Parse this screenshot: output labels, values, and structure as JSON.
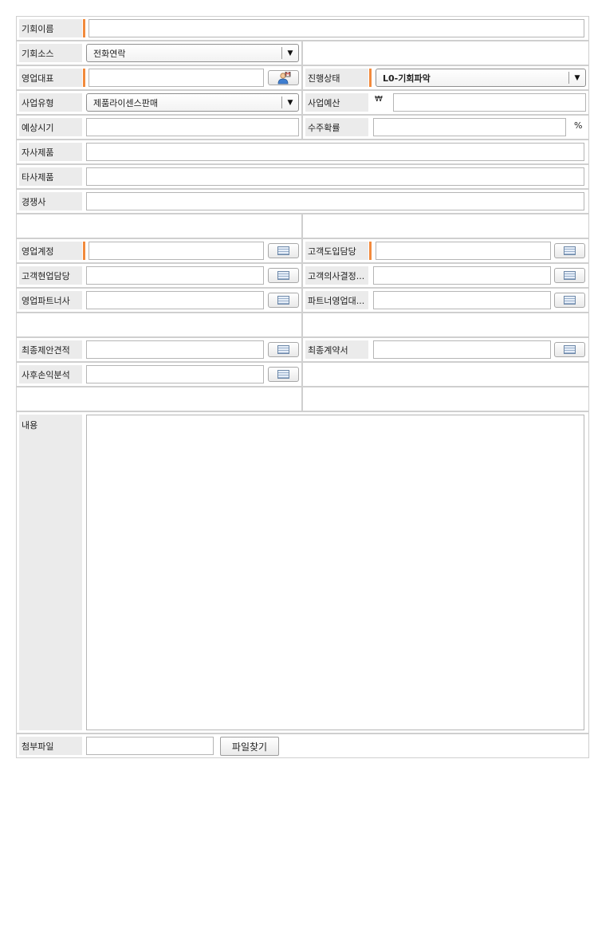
{
  "fields": {
    "opportunity_name": {
      "label": "기회이름",
      "value": ""
    },
    "opportunity_source": {
      "label": "기회소스",
      "value": "전화연락"
    },
    "sales_rep": {
      "label": "영업대표",
      "value": ""
    },
    "progress_status": {
      "label": "진행상태",
      "value": "L0-기회파악"
    },
    "business_type": {
      "label": "사업유형",
      "value": "제품라이센스판매"
    },
    "business_budget": {
      "label": "사업예산",
      "currency": "₩",
      "value": ""
    },
    "expected_time": {
      "label": "예상시기",
      "value": ""
    },
    "win_probability": {
      "label": "수주확률",
      "value": "",
      "unit": "%"
    },
    "own_products": {
      "label": "자사제품",
      "value": ""
    },
    "other_products": {
      "label": "타사제품",
      "value": ""
    },
    "competitors": {
      "label": "경쟁사",
      "value": ""
    },
    "sales_account": {
      "label": "영업계정",
      "value": ""
    },
    "customer_adoption_contact": {
      "label": "고객도입담당",
      "value": ""
    },
    "customer_field_contact": {
      "label": "고객현업담당",
      "value": ""
    },
    "customer_decision_maker": {
      "label": "고객의사결정...",
      "value": ""
    },
    "sales_partner": {
      "label": "영업파트너사",
      "value": ""
    },
    "partner_sales_rep": {
      "label": "파트너영업대...",
      "value": ""
    },
    "final_proposal_quote": {
      "label": "최종제안견적",
      "value": ""
    },
    "final_contract": {
      "label": "최종계약서",
      "value": ""
    },
    "post_profit_analysis": {
      "label": "사후손익분석",
      "value": ""
    },
    "content": {
      "label": "내용",
      "value": ""
    },
    "attachment": {
      "label": "첨부파일",
      "value": "",
      "button": "파일찾기"
    }
  },
  "icons": {
    "dropdown": "chevron-down-icon",
    "user_search": "user-search-icon",
    "calendar": "calendar-icon"
  },
  "colors": {
    "required_marker": "#f28a3c",
    "label_background": "#ebebeb",
    "border": "#cfcfcf"
  }
}
